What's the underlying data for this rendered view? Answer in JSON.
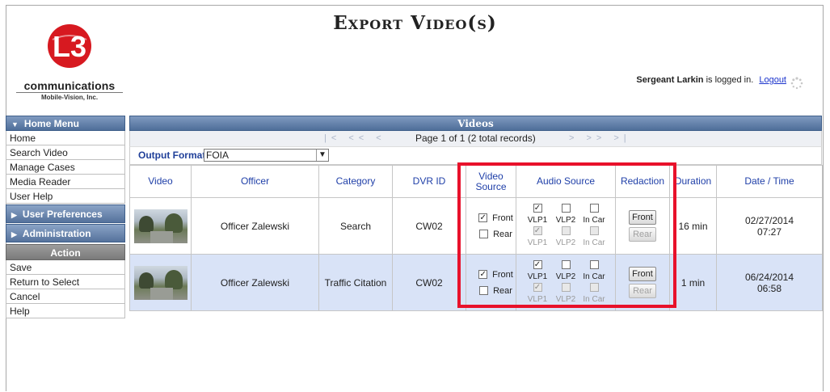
{
  "page": {
    "title": "Export Video(s)"
  },
  "logo": {
    "mark": "L3",
    "brand": "communications",
    "subtitle": "Mobile-Vision, Inc."
  },
  "user": {
    "name": "Sergeant Larkin",
    "status": "is logged in.",
    "logout": "Logout"
  },
  "home_menu": {
    "title": "Home Menu",
    "items": [
      "Home",
      "Search Video",
      "Manage Cases",
      "Media Reader",
      "User Help"
    ]
  },
  "user_preferences": {
    "title": "User Preferences"
  },
  "administration": {
    "title": "Administration"
  },
  "action_menu": {
    "title": "Action",
    "items": [
      "Save",
      "Return to Select",
      "Cancel",
      "Help"
    ]
  },
  "videos": {
    "title": "Videos",
    "page_info": "Page 1 of 1 (2 total records)",
    "nav_prev": "|< << <",
    "nav_next": "> >> >|",
    "output_format_label": "Output Format:",
    "output_format_value": "FOIA",
    "columns": [
      "Video",
      "Officer",
      "Category",
      "DVR ID",
      "Video Source",
      "Audio Source",
      "Redaction",
      "Duration",
      "Date / Time"
    ],
    "rows": [
      {
        "officer": "Officer Zalewski",
        "category": "Search",
        "dvr_id": "CW02",
        "source_front": "Front",
        "source_rear": "Rear",
        "audio_labels": [
          "VLP1",
          "VLP2",
          "In Car"
        ],
        "redaction_front": "Front",
        "redaction_rear": "Rear",
        "duration": "16 min",
        "date": "02/27/2014",
        "time": "07:27"
      },
      {
        "officer": "Officer Zalewski",
        "category": "Traffic Citation",
        "dvr_id": "CW02",
        "source_front": "Front",
        "source_rear": "Rear",
        "audio_labels": [
          "VLP1",
          "VLP2",
          "In Car"
        ],
        "redaction_front": "Front",
        "redaction_rear": "Rear",
        "duration": "1 min",
        "date": "06/24/2014",
        "time": "06:58"
      }
    ]
  },
  "colors": {
    "header_blue": "#4f6e99",
    "link_blue": "#1a33cc",
    "highlight_red": "#e8112b",
    "logo_red": "#d71920",
    "alt_row": "#d9e3f7"
  }
}
